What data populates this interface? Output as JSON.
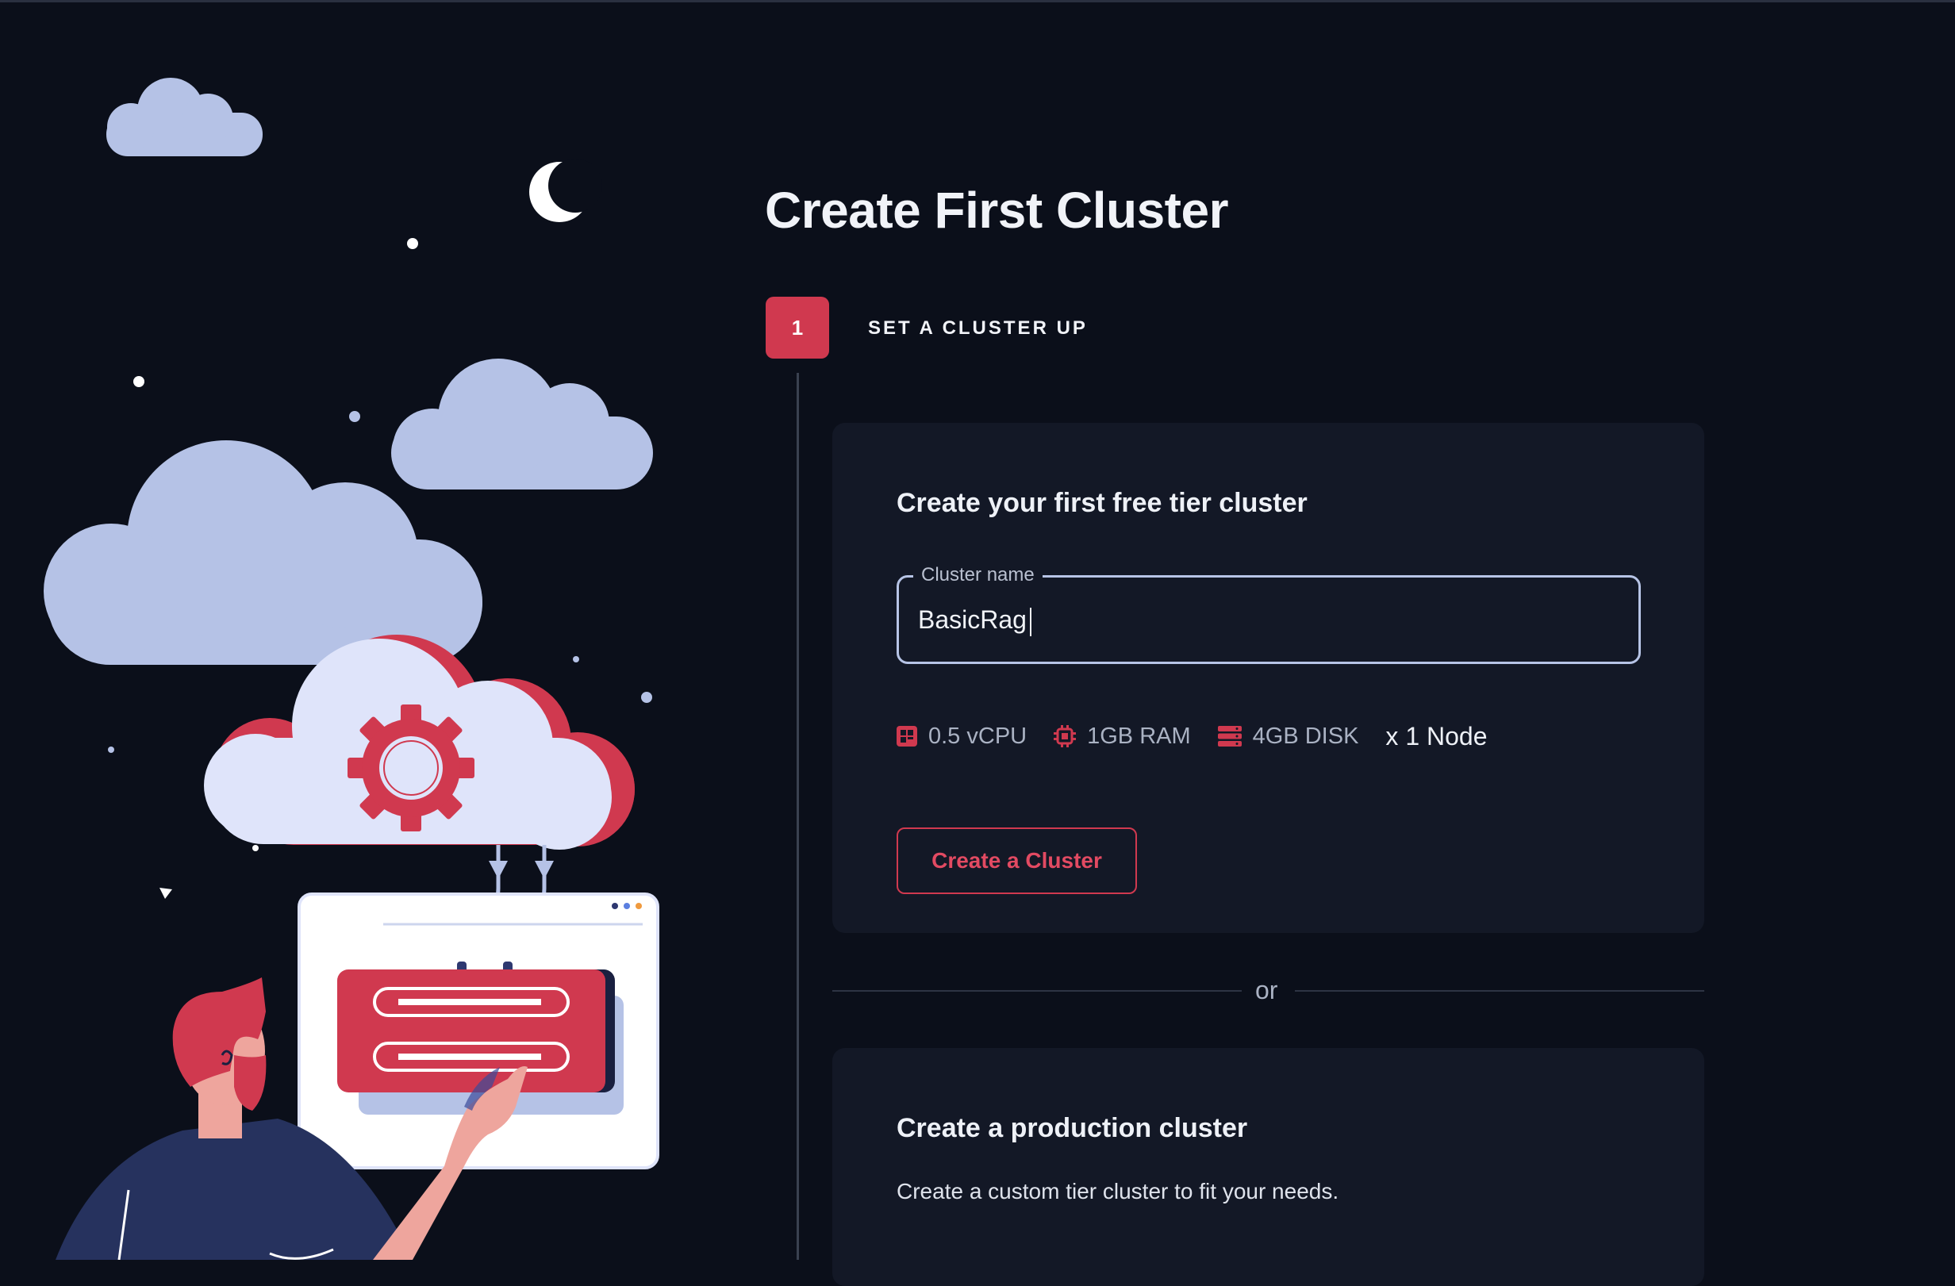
{
  "page": {
    "title": "Create First Cluster"
  },
  "stepper": {
    "step_number": "1",
    "step_label": "SET A CLUSTER UP"
  },
  "free_tier_card": {
    "title": "Create your first free tier cluster",
    "cluster_name_label": "Cluster name",
    "cluster_name_value": "BasicRag",
    "specs": {
      "cpu": "0.5 vCPU",
      "ram": "1GB RAM",
      "disk": "4GB DISK",
      "nodes": "x 1 Node"
    },
    "create_button_label": "Create a Cluster"
  },
  "divider": {
    "text": "or"
  },
  "production_card": {
    "title": "Create a production cluster",
    "description": "Create a custom tier cluster to fit your needs."
  },
  "icons": [
    "cpu-icon",
    "ram-chip-icon",
    "disk-icon",
    "moon-icon",
    "cloud-icon",
    "gear-icon"
  ],
  "colors": {
    "background": "#0b0f1a",
    "card": "#131826",
    "accent": "#d0394f",
    "cloud": "#b5c2e6",
    "text": "#f1f3f8"
  }
}
